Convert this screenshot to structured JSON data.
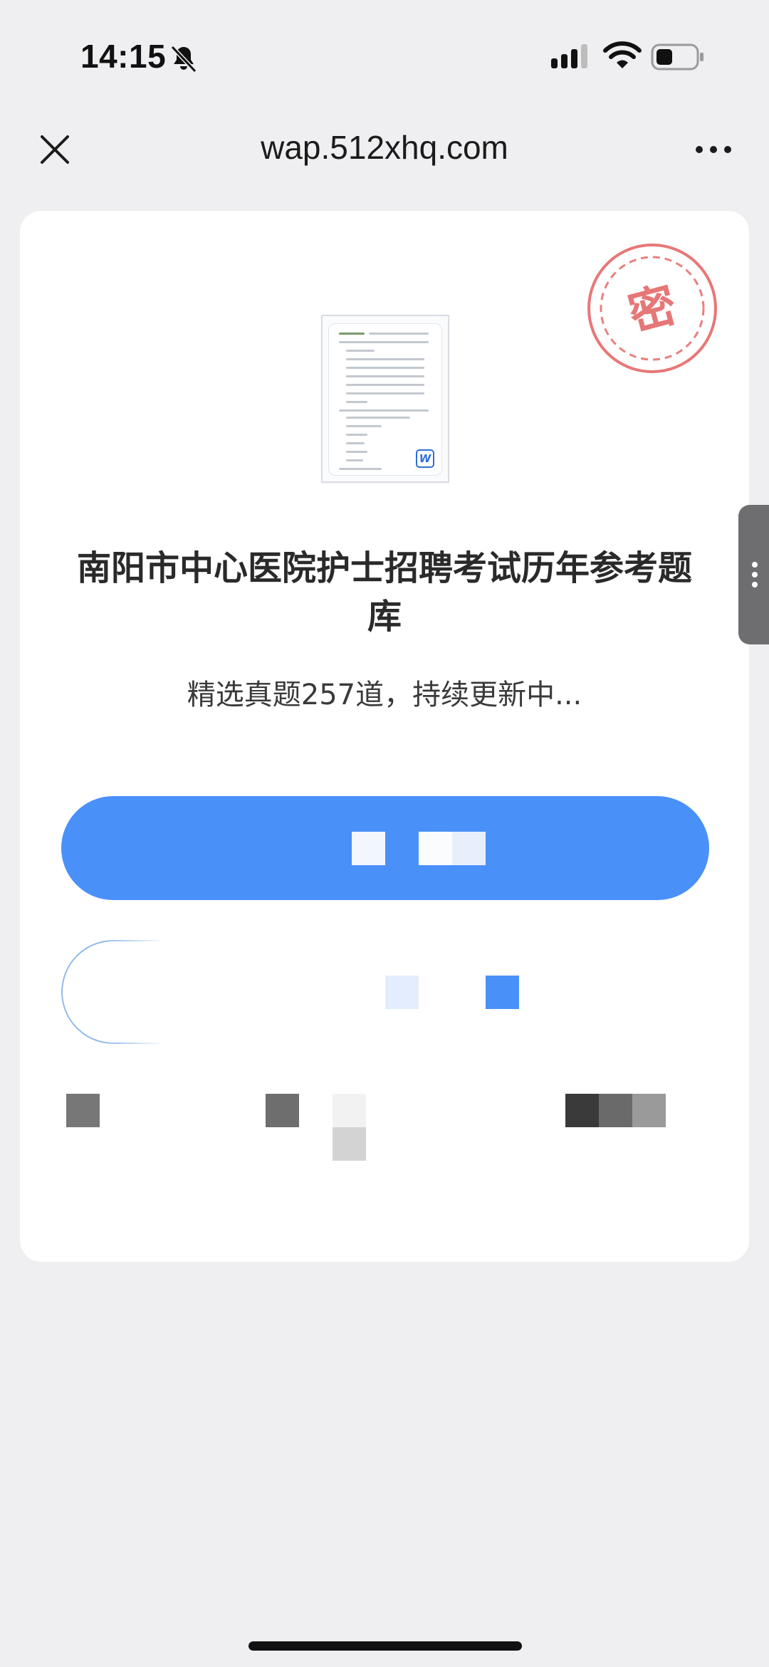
{
  "status_bar": {
    "time": "14:15",
    "icons": [
      "bell-slash-icon",
      "cellular-signal-icon",
      "wifi-icon",
      "battery-icon"
    ]
  },
  "nav": {
    "url": "wap.512xhq.com",
    "close_icon": "close-icon",
    "more_icon": "more-horizontal-icon"
  },
  "card": {
    "stamp_text": "密",
    "stamp_color": "#e04a4a",
    "document_icon": "word-document-thumbnail",
    "word_badge": "W",
    "title": "南阳市中心医院护士招聘考试历年参考题库",
    "subtitle": "精选真题257道，持续更新中...",
    "primary_button": {
      "label": "",
      "color": "#4a90f9"
    },
    "secondary_button": {
      "label": ""
    }
  },
  "side_handle_icon": "vertical-dots-icon",
  "colors": {
    "background": "#efeff1",
    "card": "#ffffff",
    "accent": "#4a90f9"
  }
}
